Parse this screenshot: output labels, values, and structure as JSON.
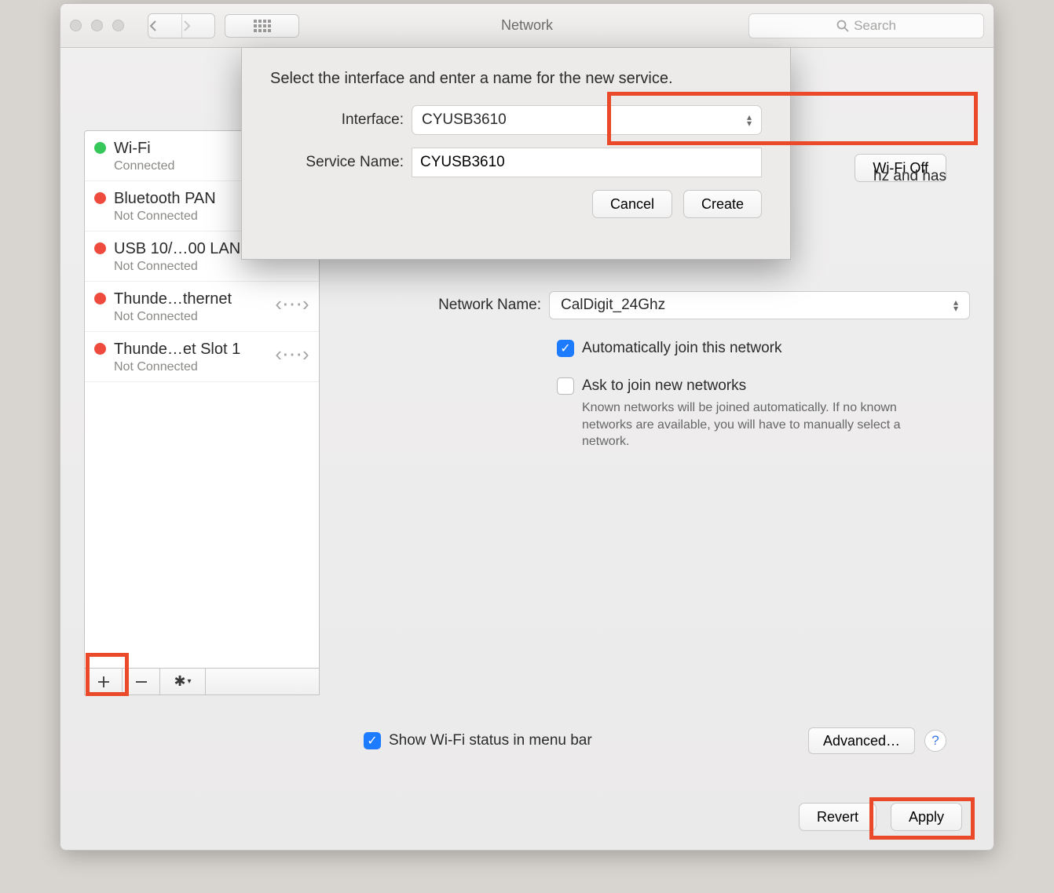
{
  "window": {
    "title": "Network",
    "searchPlaceholder": "Search"
  },
  "sidebar": {
    "services": [
      {
        "name": "Wi-Fi",
        "status": "Connected",
        "dot": "green"
      },
      {
        "name": "Bluetooth PAN",
        "status": "Not Connected",
        "dot": "red"
      },
      {
        "name": "USB 10/…00 LAN",
        "status": "Not Connected",
        "dot": "red"
      },
      {
        "name": "Thunde…thernet",
        "status": "Not Connected",
        "dot": "red"
      },
      {
        "name": "Thunde…et Slot 1",
        "status": "Not Connected",
        "dot": "red"
      }
    ]
  },
  "panel": {
    "wifiOffBtn": "Wi-Fi Off",
    "statusTail": "hz and has",
    "networkNameLabel": "Network Name:",
    "networkName": "CalDigit_24Ghz",
    "autoJoin": "Automatically join this network",
    "askJoin": "Ask to join new networks",
    "askJoinSub": "Known networks will be joined automatically. If no known networks are available, you will have to manually select a network.",
    "menuBar": "Show Wi-Fi status in menu bar",
    "advanced": "Advanced…",
    "revert": "Revert",
    "apply": "Apply"
  },
  "sheet": {
    "message": "Select the interface and enter a name for the new service.",
    "interfaceLabel": "Interface:",
    "interfaceValue": "CYUSB3610",
    "serviceNameLabel": "Service Name:",
    "serviceNameValue": "CYUSB3610",
    "cancel": "Cancel",
    "create": "Create"
  }
}
